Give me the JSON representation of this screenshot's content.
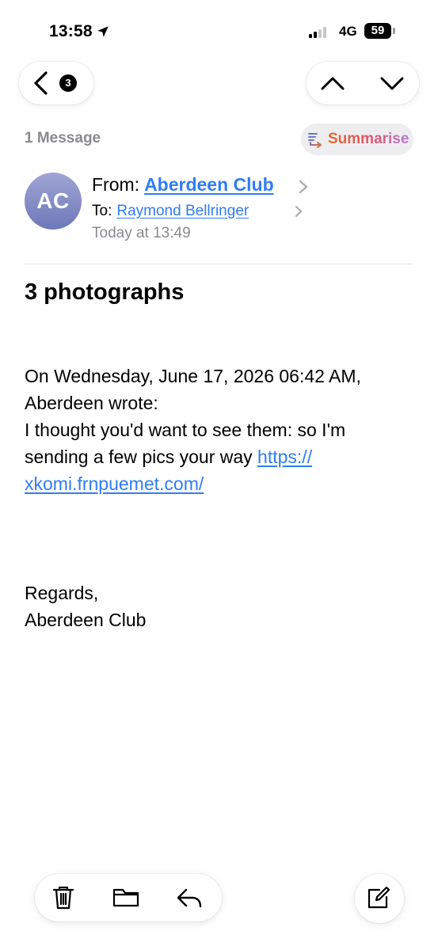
{
  "status_bar": {
    "time": "13:58",
    "network": "4G",
    "battery": "59",
    "icons": [
      "location-arrow-icon",
      "signal-bars-icon",
      "battery-icon"
    ]
  },
  "nav": {
    "unread_count": "3",
    "icons": [
      "back-chevron-icon",
      "up-chevron-icon",
      "down-chevron-icon"
    ]
  },
  "thread": {
    "message_count": "1 Message",
    "summarise_label": "Summarise",
    "summarise_icon": "summarise-icon"
  },
  "sender": {
    "initials": "AC",
    "from_label": "From:",
    "from_name": "Aberdeen Club",
    "to_label": "To:",
    "to_name": "Raymond Bellringer",
    "date": "Today at 13:49"
  },
  "message": {
    "subject": "3 photographs",
    "quote_header_1": "On Wednesday, June 17, 2026 06:42 AM,",
    "quote_header_2": "Aberdeen wrote:",
    "body_1": "I thought you'd want to see them: so I'm",
    "body_2": "sending a few pics your way ",
    "link_1": "https://",
    "link_2": "xkomi.frnpuemet.com/",
    "signoff_1": "Regards,",
    "signoff_2": "Aberdeen Club"
  },
  "toolbar": {
    "icons": [
      "trash-icon",
      "folder-icon",
      "reply-icon",
      "compose-icon"
    ]
  },
  "colors": {
    "link": "#2f7cf6",
    "secondary_text": "#8a8a8e",
    "avatar_top": "#9fa5d4",
    "avatar_bottom": "#6e78b8",
    "summarise_gradient": [
      "#e56a2c",
      "#e2546c",
      "#b47ad6"
    ]
  }
}
